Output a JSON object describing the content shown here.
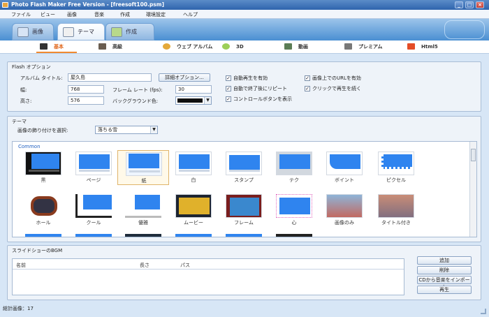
{
  "window": {
    "title": "Photo Flash Maker Free Version - [freesoft100.psm]"
  },
  "menu": [
    "ファイル",
    "ビュー",
    "画像",
    "音楽",
    "作成",
    "環境設定",
    "ヘルプ"
  ],
  "main_tabs": [
    {
      "label": "画像",
      "icon": "image-icon"
    },
    {
      "label": "テーマ",
      "icon": "theme-icon"
    },
    {
      "label": "作成",
      "icon": "create-icon"
    }
  ],
  "sub_tabs": [
    {
      "label": "基本",
      "icon": "film-icon"
    },
    {
      "label": "高級",
      "icon": "camera-icon"
    },
    {
      "label": "ウェブ アルバム",
      "icon": "web-album-icon"
    },
    {
      "label": "3D",
      "icon": "3d-icon"
    },
    {
      "label": "動画",
      "icon": "video-icon"
    },
    {
      "label": "プレミアム",
      "icon": "premium-icon"
    },
    {
      "label": "Html5",
      "icon": "html5-icon"
    }
  ],
  "flash_options": {
    "group_label": "Flash オプション",
    "album_title_label": "アルバム タイトル:",
    "album_title_value": "屋久島",
    "width_label": "幅:",
    "width_value": "768",
    "height_label": "高さ:",
    "height_value": "576",
    "framerate_label": "フレーム レート (fps):",
    "framerate_value": "30",
    "background_label": "バックグラウンド色:",
    "detail_button": "詳細オプション...",
    "checks": [
      {
        "label": "自動再生を有効",
        "checked": true
      },
      {
        "label": "画像上でのURLを有効",
        "checked": true
      },
      {
        "label": "自動で終了後にリピート",
        "checked": true
      },
      {
        "label": "クリックで再生を続く",
        "checked": true
      },
      {
        "label": "コントロールボタンを表示",
        "checked": true
      }
    ]
  },
  "theme_group": {
    "group_label": "テーマ",
    "decoration_label": "画像の飾り付けを選択:",
    "decoration_value": "落ちる雪",
    "category": "Common",
    "themes_row1": [
      "黒",
      "ページ",
      "紙",
      "白",
      "スタンプ",
      "テク",
      "ボイント",
      "ピクセル"
    ],
    "themes_row2": [
      "ホール",
      "クール",
      "優雅",
      "ムービー",
      "フレーム",
      "心",
      "画像のみ",
      "タイトル付き"
    ]
  },
  "bgm": {
    "group_label": "スライドショーのBGM",
    "columns": [
      "名前",
      "長さ",
      "パス"
    ],
    "buttons": [
      "追加",
      "削除",
      "CDから音楽をインポート",
      "再生"
    ]
  },
  "status": {
    "text": "総計画像：17"
  },
  "colors": {
    "accent_orange": "#f08a30",
    "theme_blue": "#2f84ef",
    "frame_blue": "#4a8fd2"
  }
}
